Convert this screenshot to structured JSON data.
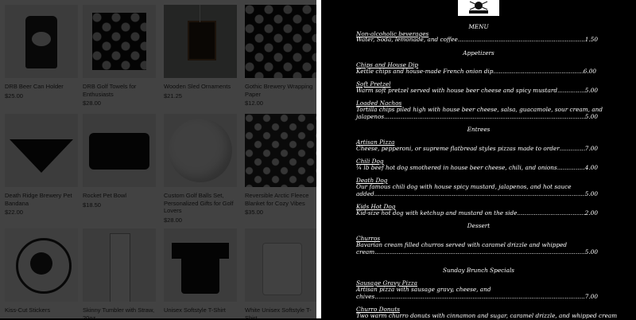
{
  "shop": {
    "products": [
      {
        "title": "DRB Beer Can Holder",
        "price": "$25.00"
      },
      {
        "title": "DRB Golf Towels for Enthusiasts",
        "price": "$28.00"
      },
      {
        "title": "Wooden Sled Ornaments",
        "price": "$21.25"
      },
      {
        "title": "Gothic Brewery Wrapping Paper",
        "price": "$12.00"
      },
      {
        "title": "Death Ridge Brewery Pet Bandana",
        "price": "$22.00"
      },
      {
        "title": "Rocket Pet Bowl",
        "price": "$18.50"
      },
      {
        "title": "Custom Golf Balls Set, Personalized Gifts for Golf Lovers",
        "price": "$28.00"
      },
      {
        "title": "Reversible Arctic Fleece Blanket for Cozy Vibes",
        "price": "$35.00"
      },
      {
        "title": "Kiss-Cut Stickers",
        "price": ""
      },
      {
        "title": "Skinny Tumbler with Straw, 20oz",
        "price": ""
      },
      {
        "title": "Unisex Softstyle T-Shirt",
        "price": ""
      },
      {
        "title": "White Unisex Softstyle T-Shirt",
        "price": ""
      }
    ]
  },
  "menu": {
    "title": "MENU",
    "sections": {
      "beverages": {
        "items": [
          {
            "name": "Non-alcoholic beverages",
            "desc": "Water, Soda, lemonade, and coffee",
            "price": "1.50"
          }
        ]
      },
      "appetizers": {
        "heading": "Appetizers",
        "items": [
          {
            "name": "Chips and House Dip",
            "desc": "Kettle chips and house-made French onion dip",
            "price": "6.00"
          },
          {
            "name": "Soft Pretzel",
            "desc": "Warm soft pretzel served with house beer cheese and spicy mustard",
            "price": "5.00"
          },
          {
            "name": "Loaded Nachos",
            "desc1": "Tortilla chips piled high with house beer cheese, salsa, guacamole, sour cream, and",
            "desc2": "jalapenos",
            "price": "5.00"
          }
        ]
      },
      "entrees": {
        "heading": "Entrees",
        "items": [
          {
            "name": "Artisan Pizza",
            "desc": "Cheese, pepperoni, or supreme flatbread styles pizzas made to order",
            "price": "7.00"
          },
          {
            "name": "Chili Dog",
            "desc": "¼ lb beef hot dog smothered in house beer cheese, chili, and onions",
            "price": "4.00"
          },
          {
            "name": "Death Dog",
            "desc1": "Our famous chili dog with house spicy mustard, jalapenos, and hot sauce",
            "desc2": "added",
            "price": "5.00"
          },
          {
            "name": "Kids Hot Dog",
            "desc": "Kid-size hot dog with ketchup and mustard on the side",
            "price": "2.00"
          }
        ]
      },
      "dessert": {
        "heading": "Dessert",
        "items": [
          {
            "name": "Churros",
            "desc1": "Bavarian cream filled churros served with caramel drizzle and whipped",
            "desc2": "cream",
            "price": "5.00"
          }
        ]
      },
      "brunch": {
        "heading": "Sunday Brunch Specials",
        "items": [
          {
            "name": "Sausage Gravy Pizza",
            "desc1": "Artisan pizza with sausage gravy, cheese, and",
            "desc2": "chives",
            "price": "7.00"
          },
          {
            "name": "Churro Donuts",
            "desc": "Two warm churro donuts with cinnamon and sugar, caramel drizzle, and whipped cream",
            "price": ""
          }
        ]
      }
    }
  }
}
